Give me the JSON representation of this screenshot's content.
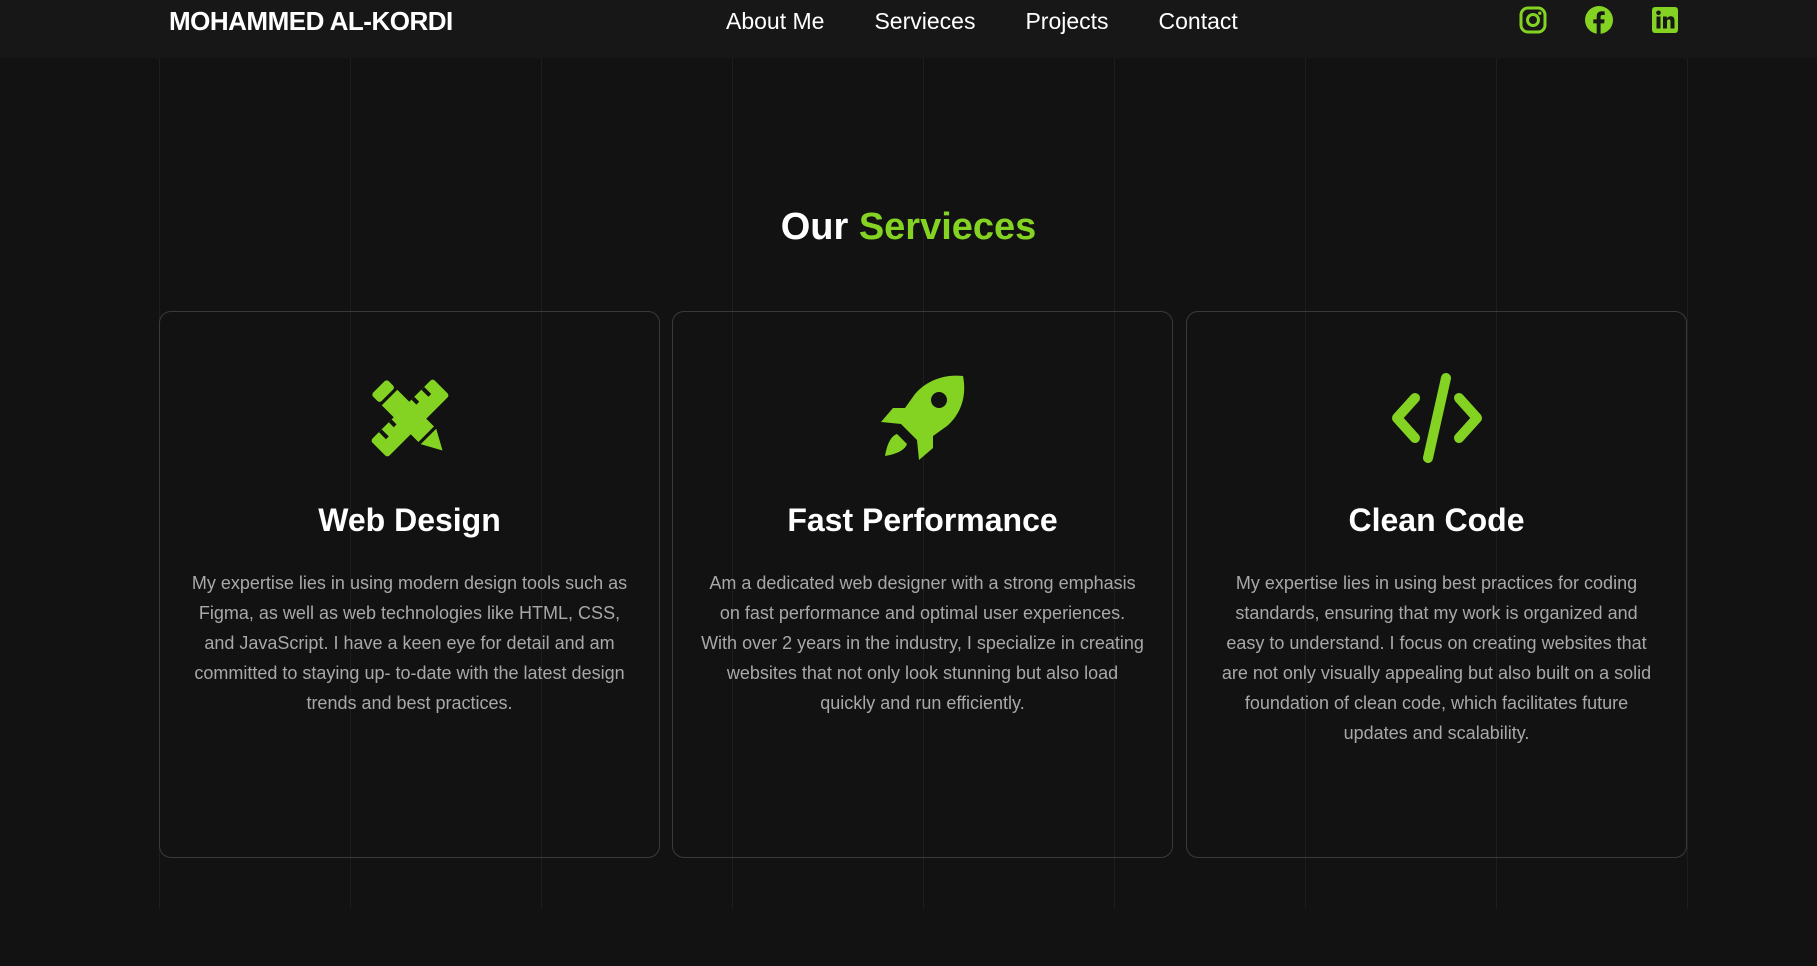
{
  "brand": {
    "name": "MOHAMMED AL-KORDI"
  },
  "nav": {
    "items": [
      {
        "label": "About Me"
      },
      {
        "label": "Servieces"
      },
      {
        "label": "Projects"
      },
      {
        "label": "Contact"
      }
    ]
  },
  "socials": [
    {
      "icon": "instagram-icon"
    },
    {
      "icon": "facebook-icon"
    },
    {
      "icon": "linkedin-icon"
    }
  ],
  "section": {
    "title_plain": "Our",
    "title_accent": "Servieces"
  },
  "cards": [
    {
      "icon": "pencil-ruler-icon",
      "title": "Web Design",
      "description": "My expertise lies in using modern design tools such as Figma, as well as web technologies like HTML, CSS, and JavaScript. I have a keen eye for detail and am committed to staying up- to-date with the latest design trends and best practices."
    },
    {
      "icon": "rocket-icon",
      "title": "Fast Performance",
      "description": "Am a dedicated web designer with a strong emphasis on fast performance and optimal user experiences. With over 2 years in the industry, I specialize in creating websites that not only look stunning but also load quickly and run efficiently."
    },
    {
      "icon": "code-icon",
      "title": "Clean Code",
      "description": "My expertise lies in using best practices for coding standards, ensuring that my work is organized and easy to understand. I focus on creating websites that are not only visually appealing but also built on a solid foundation of clean code, which facilitates future updates and scalability."
    }
  ],
  "colors": {
    "accent": "#84d322",
    "background": "#121212",
    "header_background": "#171717",
    "body_text": "#a8a8a8"
  }
}
